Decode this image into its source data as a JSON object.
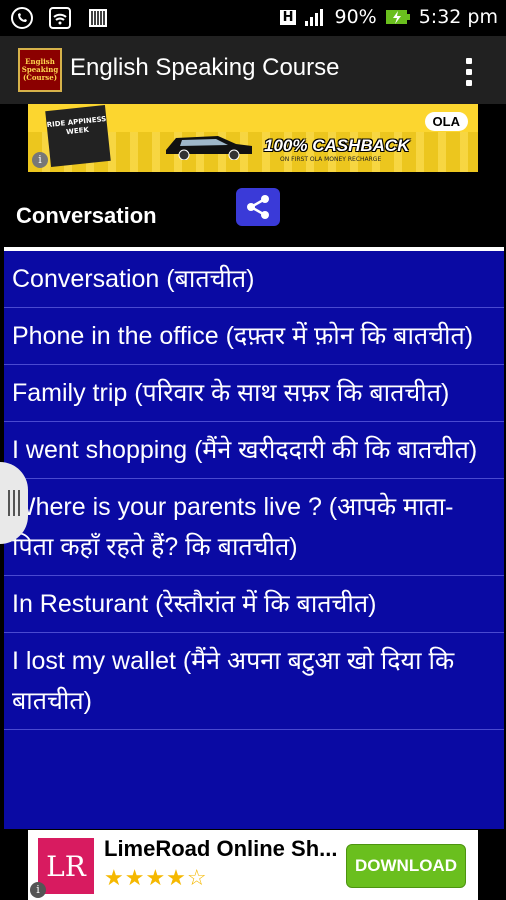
{
  "status_bar": {
    "network_type": "H",
    "battery": "90%",
    "time": "5:32 pm",
    "icons": [
      "whatsapp-icon",
      "wifi-icon",
      "barcode-icon",
      "signal-icon",
      "battery-charging-icon"
    ]
  },
  "app_bar": {
    "logo_text": "English Speaking (Course)",
    "title": "English Speaking Course",
    "menu_icon": "overflow-menu-icon"
  },
  "top_ad": {
    "badge_text": "RIDE APPINESS WEEK",
    "headline": "100% CASHBACK",
    "subtext": "ON FIRST OLA MONEY RECHARGE",
    "brand": "OLA",
    "info_icon": "i"
  },
  "panel": {
    "title": "Conversation",
    "share_icon": "share-icon",
    "items": [
      {
        "label": "Conversation (बातचीत)"
      },
      {
        "label": "Phone in the office (दफ़्तर में फ़ोन कि बातचीत)"
      },
      {
        "label": "Family trip (परिवार के साथ सफ़र कि बातचीत)"
      },
      {
        "label": "I went shopping (मैंने खरीददारी की कि बातचीत)"
      },
      {
        "label": "Where is your parents live ? (आपके माता-पिता कहाँ रहते हैं? कि बातचीत)"
      },
      {
        "label": "In Resturant (रेस्तौरांत में कि बातचीत)"
      },
      {
        "label": "I lost my wallet (मैंने अपना बटुआ खो दिया कि बातचीत)"
      }
    ]
  },
  "bottom_ad": {
    "logo_text": "LR",
    "title": "LimeRoad Online Sh...",
    "stars": "★★★★☆",
    "rating": 4,
    "button_label": "DOWNLOAD",
    "info_icon": "i"
  },
  "colors": {
    "list_background": "#0a0aa3",
    "header_background": "#000000",
    "app_bar": "#212121",
    "share_button": "#3a3ad8",
    "download_button": "#6abf1e"
  }
}
